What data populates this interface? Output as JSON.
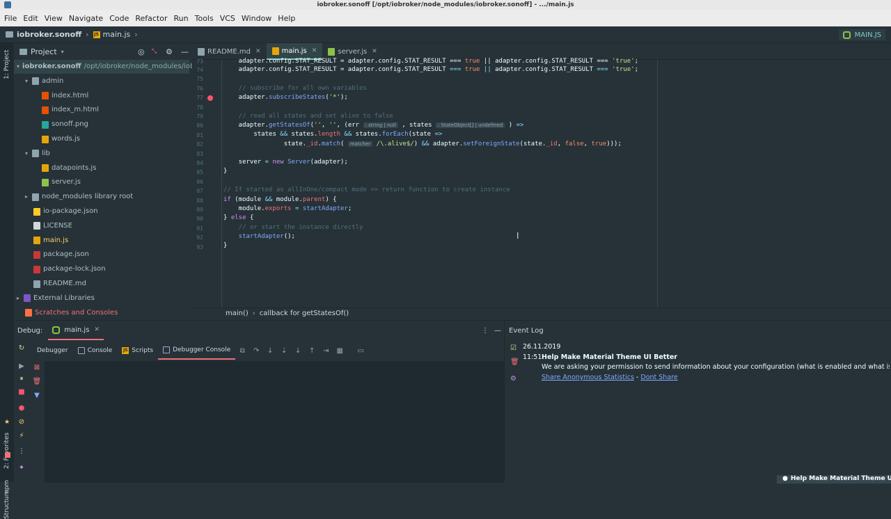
{
  "window": {
    "title": "iobroker.sonoff [/opt/iobroker/node_modules/iobroker.sonoff] - .../main.js"
  },
  "menu": [
    "File",
    "Edit",
    "View",
    "Navigate",
    "Code",
    "Refactor",
    "Run",
    "Tools",
    "VCS",
    "Window",
    "Help"
  ],
  "nav": {
    "project": "iobroker.sonoff",
    "file": "main.js",
    "run_config": "MAIN.JS"
  },
  "leftstrip": {
    "project_tab": "1: Project",
    "favorites_tab": "2: Favorites",
    "npm_tab": "npm",
    "structure_tab": "Structure"
  },
  "project": {
    "header": "Project",
    "tree": [
      {
        "label": "iobroker.sonoff",
        "extra": "/opt/iobroker/node_modules/iobr",
        "icon": "folder-icon",
        "indent": 0,
        "arrow": "▾"
      },
      {
        "label": "admin",
        "extra": "",
        "icon": "folder-icon",
        "indent": 1,
        "arrow": "▾"
      },
      {
        "label": "index.html",
        "extra": "",
        "icon": "html-file-icon",
        "indent": 2,
        "arrow": ""
      },
      {
        "label": "index_m.html",
        "extra": "",
        "icon": "html-file-icon",
        "indent": 2,
        "arrow": ""
      },
      {
        "label": "sonoff.png",
        "extra": "",
        "icon": "image-file-icon",
        "indent": 2,
        "arrow": ""
      },
      {
        "label": "words.js",
        "extra": "",
        "icon": "js-file-icon",
        "indent": 2,
        "arrow": ""
      },
      {
        "label": "lib",
        "extra": "",
        "icon": "folder-icon",
        "indent": 1,
        "arrow": "▾"
      },
      {
        "label": "datapoints.js",
        "extra": "",
        "icon": "js-file-icon",
        "indent": 2,
        "arrow": ""
      },
      {
        "label": "server.js",
        "extra": "",
        "icon": "node-file-icon",
        "indent": 2,
        "arrow": ""
      },
      {
        "label": "node_modules  library root",
        "extra": "",
        "icon": "folder-icon",
        "indent": 1,
        "arrow": "▸"
      },
      {
        "label": "io-package.json",
        "extra": "",
        "icon": "json-file-icon",
        "indent": 1,
        "arrow": ""
      },
      {
        "label": "LICENSE",
        "extra": "",
        "icon": "license-icon",
        "indent": 1,
        "arrow": ""
      },
      {
        "label": "main.js",
        "extra": "",
        "icon": "js-file-icon",
        "indent": 1,
        "arrow": ""
      },
      {
        "label": "package.json",
        "extra": "",
        "icon": "npm-file-icon",
        "indent": 1,
        "arrow": ""
      },
      {
        "label": "package-lock.json",
        "extra": "",
        "icon": "npm-file-icon",
        "indent": 1,
        "arrow": ""
      },
      {
        "label": "README.md",
        "extra": "",
        "icon": "markdown-file-icon",
        "indent": 1,
        "arrow": ""
      },
      {
        "label": "External Libraries",
        "extra": "",
        "icon": "library-icon",
        "indent": 0,
        "arrow": "▸"
      },
      {
        "label": "Scratches and Consoles",
        "extra": "",
        "icon": "scratch-icon",
        "indent": 0,
        "arrow": ""
      }
    ]
  },
  "tabs": [
    {
      "label": "README.md",
      "icon": "markdown-file-icon"
    },
    {
      "label": "main.js",
      "icon": "js-file-icon"
    },
    {
      "label": "server.js",
      "icon": "node-file-icon"
    }
  ],
  "editor": {
    "line_numbers": [
      "73",
      "74",
      "75",
      "76",
      "77",
      "78",
      "79",
      "80",
      "81",
      "82",
      "83",
      "84",
      "85",
      "86",
      "87",
      "88",
      "89",
      "90",
      "91",
      "92",
      "93"
    ],
    "breadcrumbs": [
      "main()",
      "callback for getStatesOf()"
    ]
  },
  "debug": {
    "label": "Debug:",
    "session": "main.js",
    "tabs": [
      "Debugger",
      "Console",
      "Scripts",
      "Debugger Console"
    ]
  },
  "eventlog": {
    "title": "Event Log",
    "date": "26.11.2019",
    "time": "11:51",
    "heading": "Help Make Material Theme UI Better",
    "message": "We are asking your permission to send information about your configuration (what is enabled and what is not) and fe",
    "link1": "Share Anonymous Statistics",
    "separator": " - ",
    "link2": "Dont Share",
    "balloon": "Help Make Material Theme UI"
  }
}
